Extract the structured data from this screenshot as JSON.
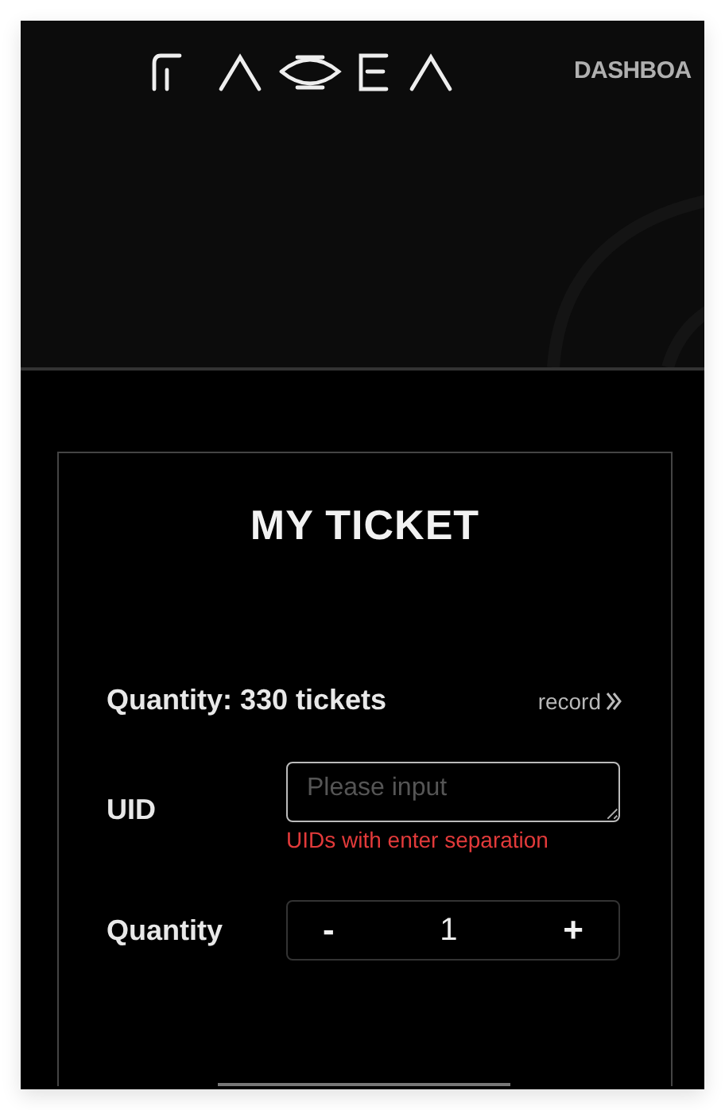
{
  "header": {
    "nav": [
      {
        "label": "DASHBOA"
      }
    ]
  },
  "card": {
    "title": "MY TICKET",
    "summary": "Quantity: 330 tickets",
    "record_link": "record",
    "uid": {
      "label": "UID",
      "placeholder": "Please input",
      "hint": "UIDs with enter separation"
    },
    "quantity": {
      "label": "Quantity",
      "minus": "-",
      "value": "1",
      "plus": "+"
    }
  }
}
